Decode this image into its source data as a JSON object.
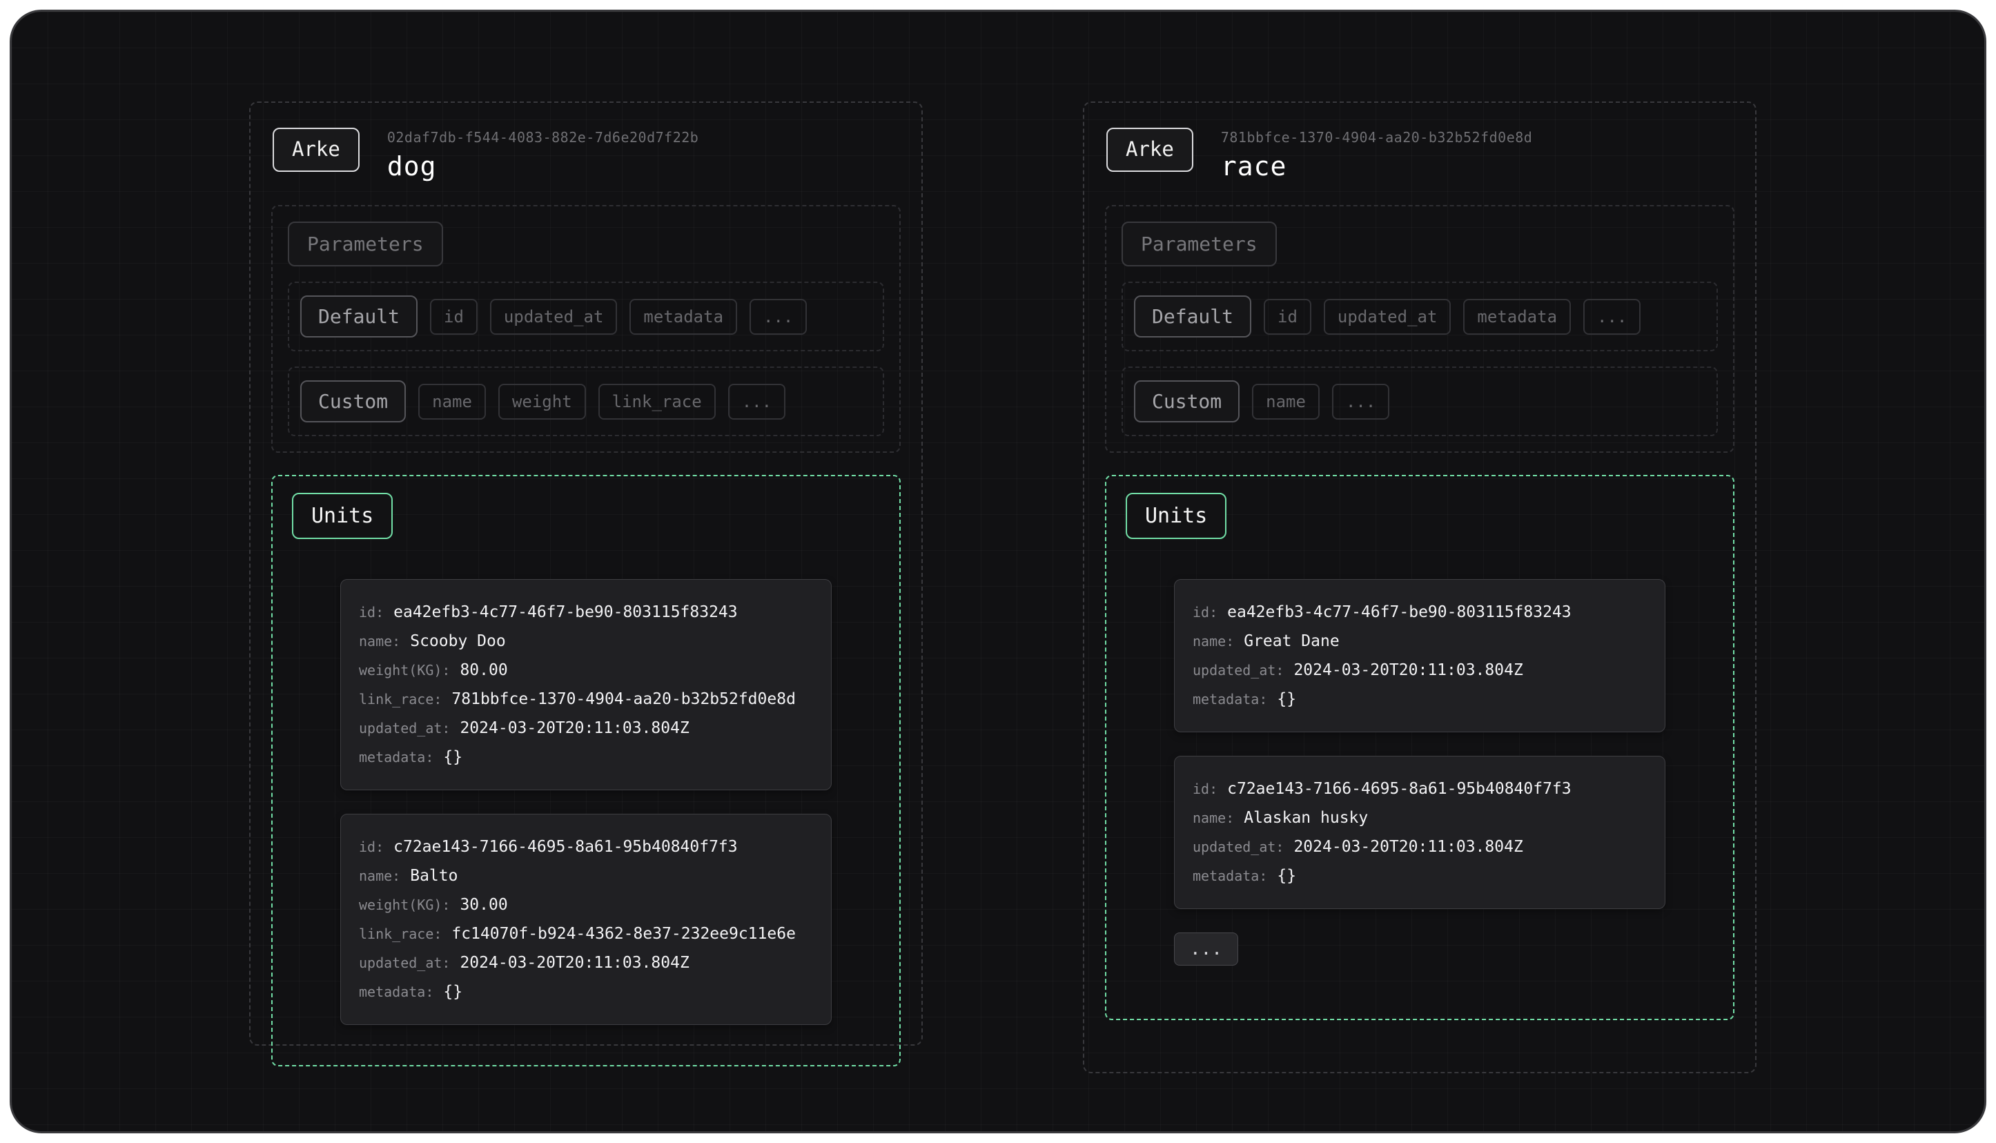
{
  "panels": [
    {
      "badge": "Arke",
      "uuid": "02daf7db-f544-4083-882e-7d6e20d7f22b",
      "name": "dog",
      "parameters_label": "Parameters",
      "default_group": {
        "label": "Default",
        "params": [
          "id",
          "updated_at",
          "metadata",
          "..."
        ]
      },
      "custom_group": {
        "label": "Custom",
        "params": [
          "name",
          "weight",
          "link_race",
          "..."
        ]
      },
      "units_label": "Units",
      "units": [
        {
          "lines": [
            {
              "k": "id:",
              "v": "ea42efb3-4c77-46f7-be90-803115f83243"
            },
            {
              "k": "name:",
              "v": "Scooby Doo"
            },
            {
              "k": "weight(KG):",
              "v": "80.00"
            },
            {
              "k": "link_race:",
              "v": "781bbfce-1370-4904-aa20-b32b52fd0e8d"
            },
            {
              "k": "updated_at:",
              "v": "2024-03-20T20:11:03.804Z"
            },
            {
              "k": "metadata:",
              "v": "{}"
            }
          ]
        },
        {
          "lines": [
            {
              "k": "id:",
              "v": "c72ae143-7166-4695-8a61-95b40840f7f3"
            },
            {
              "k": "name:",
              "v": "Balto"
            },
            {
              "k": "weight(KG):",
              "v": "30.00"
            },
            {
              "k": "link_race:",
              "v": "fc14070f-b924-4362-8e37-232ee9c11e6e"
            },
            {
              "k": "updated_at:",
              "v": "2024-03-20T20:11:03.804Z"
            },
            {
              "k": "metadata:",
              "v": "{}"
            }
          ]
        }
      ]
    },
    {
      "badge": "Arke",
      "uuid": "781bbfce-1370-4904-aa20-b32b52fd0e8d",
      "name": "race",
      "parameters_label": "Parameters",
      "default_group": {
        "label": "Default",
        "params": [
          "id",
          "updated_at",
          "metadata",
          "..."
        ]
      },
      "custom_group": {
        "label": "Custom",
        "params": [
          "name",
          "..."
        ]
      },
      "units_label": "Units",
      "units": [
        {
          "lines": [
            {
              "k": "id:",
              "v": "ea42efb3-4c77-46f7-be90-803115f83243"
            },
            {
              "k": "name:",
              "v": "Great Dane"
            },
            {
              "k": "updated_at:",
              "v": "2024-03-20T20:11:03.804Z"
            },
            {
              "k": "metadata:",
              "v": "{}"
            }
          ]
        },
        {
          "lines": [
            {
              "k": "id:",
              "v": "c72ae143-7166-4695-8a61-95b40840f7f3"
            },
            {
              "k": "name:",
              "v": "Alaskan husky"
            },
            {
              "k": "updated_at:",
              "v": "2024-03-20T20:11:03.804Z"
            },
            {
              "k": "metadata:",
              "v": "{}"
            }
          ]
        }
      ],
      "more_label": "..."
    }
  ]
}
